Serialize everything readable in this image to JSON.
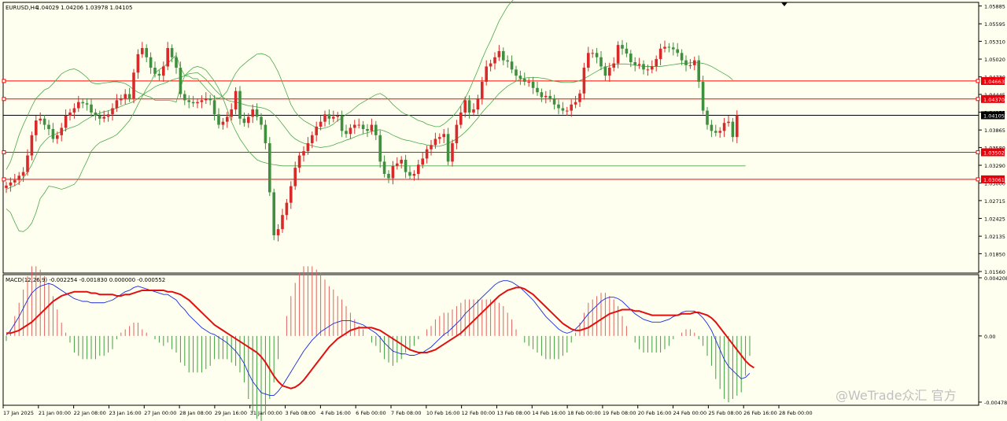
{
  "chart_info": {
    "symbol": "EURUSD,H4",
    "ohlc": "1.04029 1.04206 1.03978 1.04105",
    "macd_label": "MACD(12,26,9) -0.002254 -0.001830 0.000000 -0.000552",
    "watermark": "@WeTrade众汇 官方"
  },
  "chart_data": {
    "type": "candlestick",
    "price_axis": {
      "min": 1.0156,
      "max": 1.0588,
      "ticks": [
        "1.05885",
        "1.05595",
        "1.05310",
        "1.05020",
        "1.04730",
        "1.04445",
        "1.04155",
        "1.03865",
        "1.03580",
        "1.03290",
        "1.03000",
        "1.02715",
        "1.02425",
        "1.02135",
        "1.01850",
        "1.01560"
      ],
      "tick_values": [
        1.05885,
        1.05595,
        1.0531,
        1.0502,
        1.0473,
        1.04445,
        1.04155,
        1.03865,
        1.0358,
        1.0329,
        1.03,
        1.02715,
        1.02425,
        1.02135,
        1.0185,
        1.0156
      ]
    },
    "levels": [
      {
        "value": 1.04663,
        "label": "1.04663",
        "color": "#ff0000"
      },
      {
        "value": 1.0437,
        "label": "1.04370",
        "color": "#ff0000"
      },
      {
        "value": 1.04105,
        "label": "1.04105",
        "color": "#000000"
      },
      {
        "value": 1.03502,
        "label": "1.03502",
        "color": "#ff0000"
      },
      {
        "value": 1.03061,
        "label": "1.03061",
        "color": "#ff0000"
      }
    ],
    "x_labels": [
      "17 Jan 2025",
      "21 Jan 00:00",
      "22 Jan 08:00",
      "23 Jan 16:00",
      "27 Jan 00:00",
      "28 Jan 08:00",
      "29 Jan 16:00",
      "31 Jan 00:00",
      "3 Feb 08:00",
      "4 Feb 16:00",
      "6 Feb 00:00",
      "7 Feb 08:00",
      "10 Feb 16:00",
      "12 Feb 00:00",
      "13 Feb 08:00",
      "14 Feb 16:00",
      "18 Feb 00:00",
      "19 Feb 08:00",
      "20 Feb 16:00",
      "24 Feb 00:00",
      "25 Feb 08:00",
      "26 Feb 16:00",
      "28 Feb 00:00"
    ],
    "close": [
      1.0296,
      1.0301,
      1.0305,
      1.0312,
      1.0318,
      1.0345,
      1.0378,
      1.0402,
      1.0405,
      1.0395,
      1.0388,
      1.0372,
      1.0378,
      1.039,
      1.041,
      1.0415,
      1.0422,
      1.0432,
      1.043,
      1.0428,
      1.0415,
      1.041,
      1.0405,
      1.0408,
      1.0412,
      1.0422,
      1.0435,
      1.0438,
      1.0445,
      1.0438,
      1.048,
      1.051,
      1.052,
      1.0505,
      1.0488,
      1.0478,
      1.0475,
      1.049,
      1.052,
      1.0505,
      1.0488,
      1.0445,
      1.0435,
      1.0432,
      1.043,
      1.0432,
      1.0435,
      1.0438,
      1.0435,
      1.0412,
      1.0395,
      1.04,
      1.0408,
      1.042,
      1.045,
      1.0405,
      1.0398,
      1.0408,
      1.042,
      1.0408,
      1.0395,
      1.0365,
      1.0285,
      1.0215,
      1.0225,
      1.0248,
      1.0268,
      1.0295,
      1.0325,
      1.0345,
      1.0352,
      1.0365,
      1.0378,
      1.0392,
      1.04,
      1.0412,
      1.0405,
      1.0408,
      1.041,
      1.0385,
      1.038,
      1.039,
      1.0395,
      1.0395,
      1.0388,
      1.0385,
      1.0395,
      1.0378,
      1.0335,
      1.0315,
      1.0308,
      1.0328,
      1.0332,
      1.0338,
      1.0318,
      1.0312,
      1.0315,
      1.033,
      1.034,
      1.0355,
      1.0362,
      1.0372,
      1.0375,
      1.038,
      1.0335,
      1.0365,
      1.0395,
      1.0415,
      1.0435,
      1.0415,
      1.042,
      1.0438,
      1.0465,
      1.049,
      1.0495,
      1.0505,
      1.0515,
      1.05,
      1.0498,
      1.0485,
      1.0475,
      1.047,
      1.0465,
      1.0465,
      1.0455,
      1.0448,
      1.044,
      1.0442,
      1.0438,
      1.0428,
      1.0422,
      1.0418,
      1.0418,
      1.0428,
      1.0432,
      1.0446,
      1.0488,
      1.0512,
      1.0512,
      1.0505,
      1.049,
      1.0475,
      1.0488,
      1.0495,
      1.0525,
      1.0519,
      1.0511,
      1.0497,
      1.0492,
      1.0494,
      1.0485,
      1.0485,
      1.049,
      1.0502,
      1.0519,
      1.0522,
      1.0521,
      1.0518,
      1.0512,
      1.05,
      1.0492,
      1.0492,
      1.05,
      1.0465,
      1.0418,
      1.0395,
      1.0385,
      1.0382,
      1.0385,
      1.0398,
      1.04,
      1.0375,
      1.04105
    ],
    "bb_upper": [
      1.0322,
      1.0335,
      1.0356,
      1.0378,
      1.0395,
      1.041,
      1.0425,
      1.0438,
      1.0445,
      1.0452,
      1.0455,
      1.0462,
      1.047,
      1.0478,
      1.0482,
      1.0485,
      1.0486,
      1.0483,
      1.0478,
      1.0472,
      1.0464,
      1.0462,
      1.0462,
      1.0463,
      1.0464,
      1.0465,
      1.0465,
      1.0464,
      1.0462,
      1.0458,
      1.0452,
      1.0448,
      1.0445,
      1.0442,
      1.044,
      1.0435,
      1.0435,
      1.0435,
      1.0435,
      1.0434,
      1.0432,
      1.0456,
      1.0475,
      1.0482,
      1.0488,
      1.049,
      1.0488,
      1.0484,
      1.0475,
      1.0466,
      1.0454,
      1.0438,
      1.042,
      1.04,
      1.0385,
      1.0372,
      1.0362,
      1.0352,
      1.0345,
      1.0338,
      1.0335,
      1.0333,
      1.0331,
      1.033,
      1.0329,
      1.0328,
      1.0328,
      1.0328,
      1.0328,
      1.0328,
      1.0328,
      1.0328,
      1.0328,
      1.0328,
      1.0328,
      1.0328,
      1.0328,
      1.0328,
      1.0328,
      1.0328,
      1.0328,
      1.0328,
      1.0328,
      1.0328,
      1.0328,
      1.0328,
      1.0328,
      1.0328,
      1.0328,
      1.0328,
      1.0328,
      1.0328,
      1.0328,
      1.0328,
      1.0328,
      1.0328,
      1.0328,
      1.0328,
      1.0328,
      1.0328,
      1.0328,
      1.0328,
      1.0328,
      1.0328,
      1.0328,
      1.0328,
      1.0328,
      1.0328,
      1.0328,
      1.0328,
      1.0328,
      1.0328,
      1.0328,
      1.0328,
      1.0328,
      1.0328,
      1.0328,
      1.0328,
      1.0328,
      1.0328,
      1.0328,
      1.0328,
      1.0328,
      1.0328,
      1.0328,
      1.0328,
      1.0328,
      1.0328,
      1.0328,
      1.0328,
      1.0328,
      1.0328,
      1.0328,
      1.0328,
      1.0328,
      1.0328,
      1.0328,
      1.0328,
      1.0328,
      1.0328,
      1.0328,
      1.0328,
      1.0328,
      1.0328,
      1.0328,
      1.0328,
      1.0328,
      1.0328,
      1.0328,
      1.0328,
      1.0328,
      1.0328,
      1.0328,
      1.0328,
      1.0328,
      1.0328,
      1.0328,
      1.0328,
      1.0328,
      1.0328,
      1.0328,
      1.0328,
      1.0328,
      1.0328,
      1.0328,
      1.0328,
      1.0328,
      1.0328,
      1.0328,
      1.0328,
      1.0328,
      1.0328,
      1.0328,
      1.0328,
      1.0328
    ],
    "bb_mid": [
      1.029,
      1.0293,
      1.0296,
      1.03,
      1.0308,
      1.0318,
      1.033,
      1.0345,
      1.036,
      1.0368,
      1.0375,
      1.0378,
      1.0381,
      1.0384,
      1.0387,
      1.039,
      1.0392,
      1.0395,
      1.04,
      1.0404,
      1.0408,
      1.0411,
      1.0414,
      1.0416,
      1.0418,
      1.042,
      1.0422,
      1.0425,
      1.0428,
      1.043,
      1.0433,
      1.0438,
      1.0443,
      1.0448,
      1.0452,
      1.0457,
      1.046,
      1.0462,
      1.0465,
      1.0468,
      1.047,
      1.0472,
      1.0475,
      1.0478,
      1.0479,
      1.048,
      1.0475,
      1.0469,
      1.0461,
      1.0453,
      1.0446,
      1.044,
      1.0435,
      1.0433,
      1.0432,
      1.043,
      1.0428,
      1.0426,
      1.0425,
      1.0424,
      1.0423,
      1.0421,
      1.0418,
      1.0412,
      1.0405,
      1.0396,
      1.0387,
      1.0378,
      1.0372,
      1.0368,
      1.0365,
      1.0363,
      1.0361,
      1.0359,
      1.0358,
      1.0359,
      1.036,
      1.0362,
      1.0365,
      1.0367,
      1.037,
      1.0372,
      1.0375,
      1.0378,
      1.038,
      1.0382,
      1.0384,
      1.0386,
      1.0387,
      1.0385,
      1.0382,
      1.0378,
      1.0375,
      1.0372,
      1.037,
      1.0369,
      1.0367,
      1.0365,
      1.0364,
      1.0362,
      1.0361,
      1.036,
      1.036,
      1.0362,
      1.0365,
      1.0368,
      1.0372,
      1.0377,
      1.0383,
      1.039,
      1.0398,
      1.0406,
      1.0415,
      1.0423,
      1.043,
      1.0438,
      1.0446,
      1.0452,
      1.0458,
      1.0462,
      1.0466,
      1.0469,
      1.0471,
      1.0472,
      1.0472,
      1.0472,
      1.0471,
      1.047,
      1.0468,
      1.0466,
      1.0465,
      1.0464,
      1.0464,
      1.0464,
      1.0465,
      1.0467,
      1.047,
      1.0474,
      1.0478,
      1.0482,
      1.0486,
      1.0489,
      1.0491,
      1.0493,
      1.0494,
      1.0494,
      1.0494,
      1.0493,
      1.0492,
      1.0491,
      1.049,
      1.049,
      1.049,
      1.049,
      1.049,
      1.0491,
      1.0492,
      1.0493,
      1.0494,
      1.0495,
      1.0495,
      1.0496,
      1.0496,
      1.0496,
      1.0495,
      1.0493,
      1.049,
      1.0486,
      1.0482,
      1.0478,
      1.0474,
      1.0468
    ],
    "bb_lower": [
      1.0258,
      1.0252,
      1.0236,
      1.0222,
      1.0221,
      1.0226,
      1.0235,
      1.0252,
      1.0275,
      1.0284,
      1.0295,
      1.0294,
      1.0292,
      1.029,
      1.0292,
      1.0295,
      1.0298,
      1.0307,
      1.0322,
      1.0336,
      1.0352,
      1.036,
      1.0366,
      1.0369,
      1.0372,
      1.0375,
      1.0379,
      1.0386,
      1.0394,
      1.0402,
      1.0414,
      1.0428,
      1.0441,
      1.0454,
      1.0464,
      1.0479,
      1.0485,
      1.0489,
      1.0495,
      1.0502,
      1.0508,
      1.0488,
      1.0475,
      1.0474,
      1.047,
      1.047,
      1.0462,
      1.0454,
      1.0447,
      1.044,
      1.0438,
      1.0442,
      1.045,
      1.0466,
      1.0479,
      1.0488,
      1.0494,
      1.05,
      1.0505,
      1.051,
      1.0511,
      1.0509,
      1.0505,
      1.0494,
      1.0481,
      1.0464,
      1.0446,
      1.0428,
      1.0416,
      1.0408,
      1.0402,
      1.0398,
      1.0394,
      1.039,
      1.0388,
      1.039,
      1.0392,
      1.0396,
      1.0402,
      1.0406,
      1.0412,
      1.0416,
      1.0422,
      1.0428,
      1.0432,
      1.0436,
      1.044,
      1.0444,
      1.0446,
      1.0442,
      1.0436,
      1.0428,
      1.0422,
      1.0416,
      1.0412,
      1.041,
      1.0406,
      1.0402,
      1.04,
      1.0396,
      1.0394,
      1.0392,
      1.0392,
      1.0396,
      1.0402,
      1.0408,
      1.0416,
      1.0426,
      1.0438,
      1.0452,
      1.0468,
      1.0484,
      1.0502,
      1.0518,
      1.0532,
      1.0548,
      1.0564,
      1.0576,
      1.0588,
      1.0596,
      1.0604,
      1.061,
      1.0614,
      1.0616,
      1.0616,
      1.0616,
      1.0614,
      1.0612,
      1.0608,
      1.0604,
      1.0602,
      1.06,
      1.06,
      1.06,
      1.0602,
      1.0606,
      1.0612,
      1.062,
      1.0628,
      1.0636,
      1.0644,
      1.065,
      1.0654,
      1.0658,
      1.066,
      1.066,
      1.066,
      1.0658,
      1.0656,
      1.0654,
      1.0652,
      1.0652,
      1.0652,
      1.0652,
      1.0652,
      1.0654,
      1.0656,
      1.0658,
      1.066,
      1.0662,
      1.0662,
      1.0664,
      1.0664,
      1.0664,
      1.0662,
      1.0658,
      1.0652,
      1.0644,
      1.0636,
      1.0628,
      1.062,
      1.0608
    ],
    "macd": {
      "scale_labels": [
        "0.004208",
        "0.00",
        "-0.004787"
      ],
      "scale_values": [
        0.004208,
        0,
        -0.004787
      ],
      "macd_line": [
        5e-05,
        0.0004,
        0.0009,
        0.0014,
        0.002,
        0.0026,
        0.0031,
        0.0034,
        0.0036,
        0.0037,
        0.0038,
        0.0037,
        0.0035,
        0.0033,
        0.0031,
        0.0029,
        0.0027,
        0.0026,
        0.0025,
        0.0025,
        0.0024,
        0.0024,
        0.0024,
        0.0024,
        0.0025,
        0.0026,
        0.0028,
        0.003,
        0.0032,
        0.0033,
        0.0035,
        0.0036,
        0.0035,
        0.0034,
        0.0033,
        0.0032,
        0.0031,
        0.003,
        0.003,
        0.0028,
        0.0026,
        0.0022,
        0.0019,
        0.0015,
        0.0012,
        0.0009,
        0.0006,
        0.0004,
        0.0002,
        0.0001,
        -0.0001,
        -0.0003,
        -0.0005,
        -0.0008,
        -0.0011,
        -0.0015,
        -0.002,
        -0.0027,
        -0.0033,
        -0.0037,
        -0.0041,
        -0.0042,
        -0.0043,
        -0.0043,
        -0.004,
        -0.0036,
        -0.0031,
        -0.0026,
        -0.0021,
        -0.0016,
        -0.0011,
        -0.0007,
        -0.0003,
        0,
        0.0003,
        0.0005,
        0.0007,
        0.0009,
        0.001,
        0.0011,
        0.0011,
        0.0011,
        0.001,
        0.0009,
        0.0008,
        0.0006,
        0.0004,
        0.0002,
        -0.0001,
        -0.0005,
        -0.0008,
        -0.0011,
        -0.0012,
        -0.0013,
        -0.0013,
        -0.0014,
        -0.0014,
        -0.0013,
        -0.0012,
        -0.001,
        -0.0008,
        -0.0005,
        -0.0002,
        0.0001,
        0.0003,
        0.0006,
        0.0009,
        0.0012,
        0.0016,
        0.0019,
        0.0022,
        0.0025,
        0.0028,
        0.0031,
        0.0034,
        0.0037,
        0.0039,
        0.004,
        0.004,
        0.0039,
        0.0037,
        0.0035,
        0.0032,
        0.0029,
        0.0026,
        0.0022,
        0.0018,
        0.0014,
        0.0011,
        0.0008,
        0.0005,
        0.0003,
        0.0002,
        0.0003,
        0.0005,
        0.0008,
        0.0012,
        0.0016,
        0.0019,
        0.0022,
        0.0025,
        0.0027,
        0.0028,
        0.0028,
        0.0027,
        0.0025,
        0.0022,
        0.0019,
        0.0016,
        0.0014,
        0.0012,
        0.0011,
        0.001,
        0.001,
        0.001,
        0.0011,
        0.0012,
        0.0014,
        0.0015,
        0.0017,
        0.0018,
        0.0018,
        0.0018,
        0.0016,
        0.0013,
        0.0009,
        0.0004,
        -0.0003,
        -0.001,
        -0.0017,
        -0.0022,
        -0.0025,
        -0.0028,
        -0.0031,
        -0.003,
        -0.0027
      ],
      "signal_line": [
        0.0002,
        0.0002,
        0.0003,
        0.0004,
        0.0006,
        0.0008,
        0.001,
        0.0013,
        0.0016,
        0.0019,
        0.0022,
        0.0025,
        0.0027,
        0.0029,
        0.003,
        0.0031,
        0.0032,
        0.0032,
        0.0032,
        0.0032,
        0.0031,
        0.0031,
        0.003,
        0.003,
        0.003,
        0.003,
        0.0029,
        0.0029,
        0.003,
        0.003,
        0.0031,
        0.0032,
        0.0033,
        0.0033,
        0.0033,
        0.0033,
        0.0033,
        0.0033,
        0.0032,
        0.0032,
        0.0031,
        0.003,
        0.0028,
        0.0026,
        0.0023,
        0.002,
        0.0017,
        0.0014,
        0.0011,
        0.0008,
        0.0006,
        0.0004,
        0.0002,
        0,
        -0.0002,
        -0.0004,
        -0.0006,
        -0.0008,
        -0.001,
        -0.0012,
        -0.0015,
        -0.0019,
        -0.0024,
        -0.0029,
        -0.0033,
        -0.0036,
        -0.0037,
        -0.0038,
        -0.0037,
        -0.0035,
        -0.0032,
        -0.0028,
        -0.0024,
        -0.002,
        -0.0016,
        -0.0012,
        -0.0008,
        -0.0005,
        -0.0002,
        0,
        0.0002,
        0.0004,
        0.0005,
        0.0006,
        0.0006,
        0.0006,
        0.0006,
        0.0005,
        0.0004,
        0.0002,
        0,
        -0.0002,
        -0.0004,
        -0.0006,
        -0.0008,
        -0.001,
        -0.0011,
        -0.0012,
        -0.0012,
        -0.0012,
        -0.0011,
        -0.001,
        -0.0008,
        -0.0006,
        -0.0004,
        -0.0002,
        0,
        0.0002,
        0.0005,
        0.0008,
        0.0011,
        0.0014,
        0.0017,
        0.002,
        0.0023,
        0.0026,
        0.0029,
        0.0031,
        0.0033,
        0.0034,
        0.0035,
        0.0035,
        0.0034,
        0.0032,
        0.003,
        0.0027,
        0.0024,
        0.0021,
        0.0018,
        0.0015,
        0.0012,
        0.0009,
        0.0007,
        0.0005,
        0.0004,
        0.0004,
        0.0005,
        0.0006,
        0.0008,
        0.001,
        0.0012,
        0.0014,
        0.0016,
        0.0017,
        0.0018,
        0.0019,
        0.0019,
        0.0019,
        0.0018,
        0.0018,
        0.0017,
        0.0016,
        0.0015,
        0.0015,
        0.0015,
        0.0015,
        0.0015,
        0.0015,
        0.0015,
        0.0016,
        0.0016,
        0.0016,
        0.0017,
        0.0017,
        0.0016,
        0.0015,
        0.0013,
        0.001,
        0.0006,
        0.0002,
        -0.0002,
        -0.0006,
        -0.001,
        -0.0014,
        -0.0018,
        -0.0021,
        -0.0023
      ]
    },
    "colors": {
      "up": "#d82a2a",
      "down": "#3f8f3f",
      "bands": "#4aa84a",
      "macd_line": "#1a2bd8",
      "signal_line": "#e01010",
      "hist_pos": "#e06060",
      "hist_neg": "#3f9f3f"
    }
  }
}
